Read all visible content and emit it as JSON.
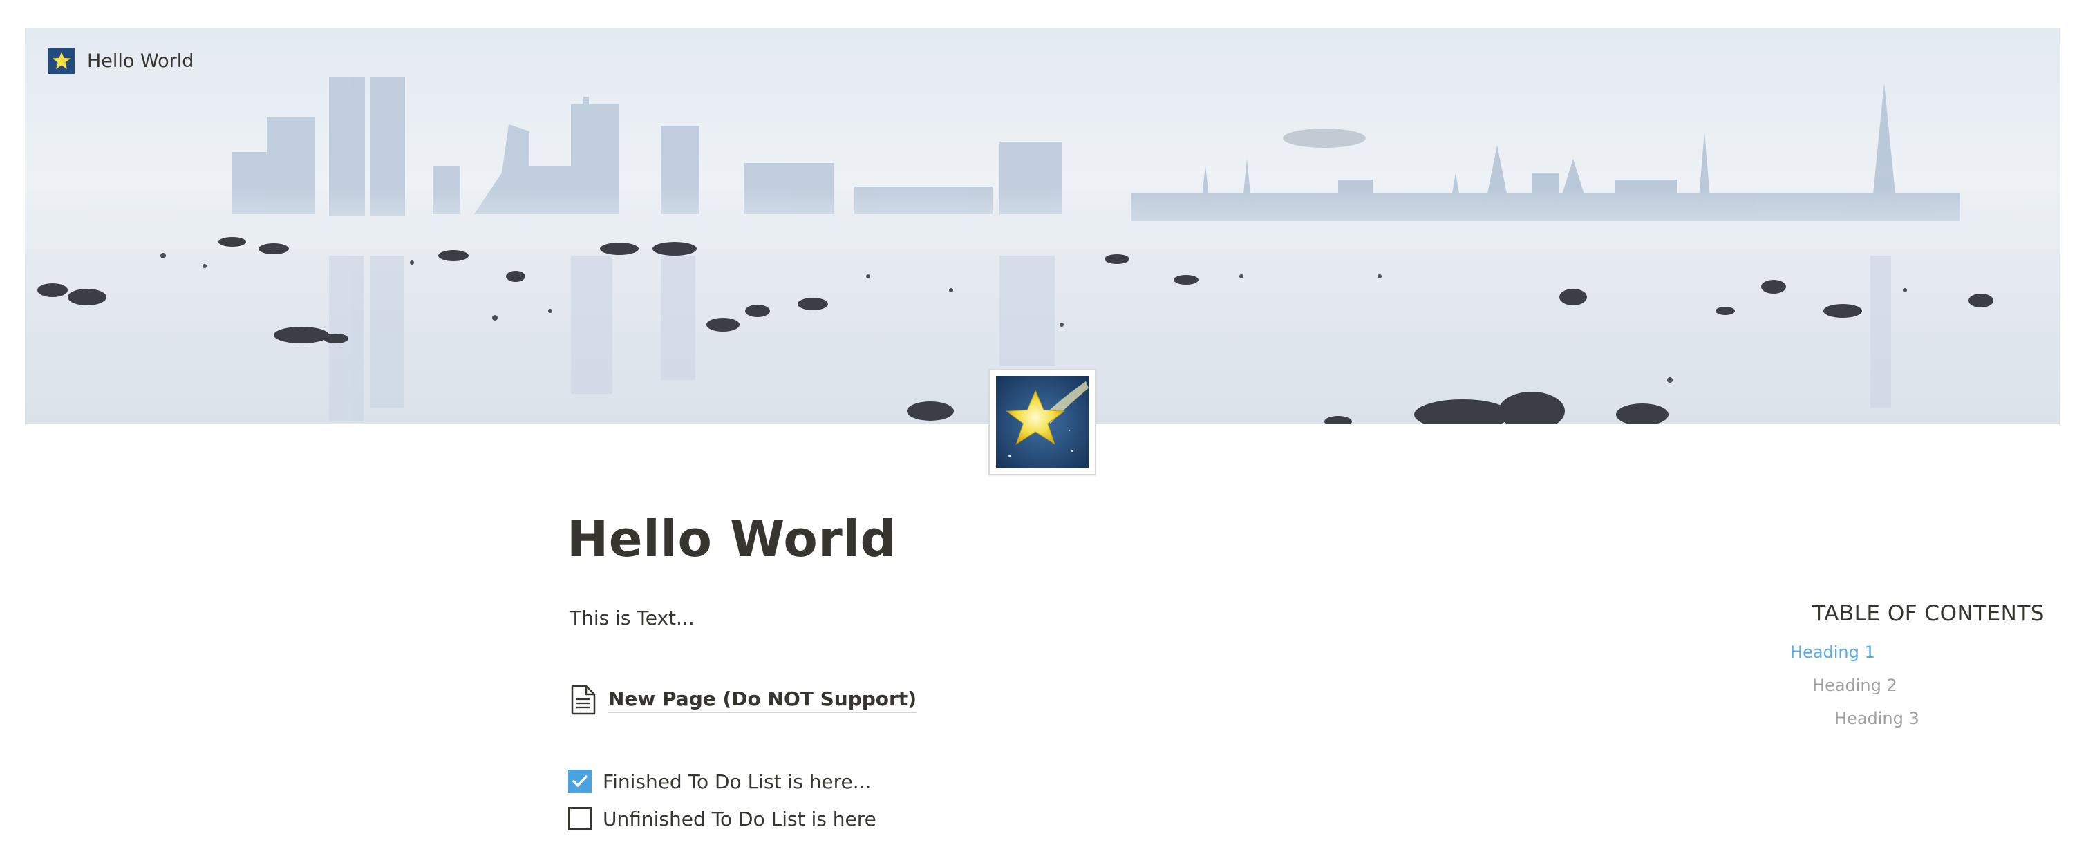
{
  "breadcrumb": {
    "label": "Hello World",
    "icon": "star-icon"
  },
  "cover": {
    "icon": "cover-image",
    "description_colors": {
      "sky": "#e3eaf1",
      "skyline": "#c5d2e0",
      "rocks": "#3a3d42"
    }
  },
  "page": {
    "icon": "shooting-star-icon",
    "title": "Hello World",
    "text": "This is Text...",
    "page_link": {
      "label": "New Page (Do NOT Support)",
      "icon": "document-icon"
    },
    "todos": [
      {
        "label": "Finished To Do List is here...",
        "checked": true
      },
      {
        "label": "Unfinished To Do List is here",
        "checked": false
      }
    ]
  },
  "toc": {
    "title": "TABLE OF CONTENTS",
    "items": [
      "Heading 1",
      "Heading 2",
      "Heading 3"
    ],
    "active_color": "#5aace0",
    "inactive_color": "#a0a0a0"
  },
  "colors": {
    "checkbox_checked": "#4aa3df",
    "text": "#37352f"
  }
}
